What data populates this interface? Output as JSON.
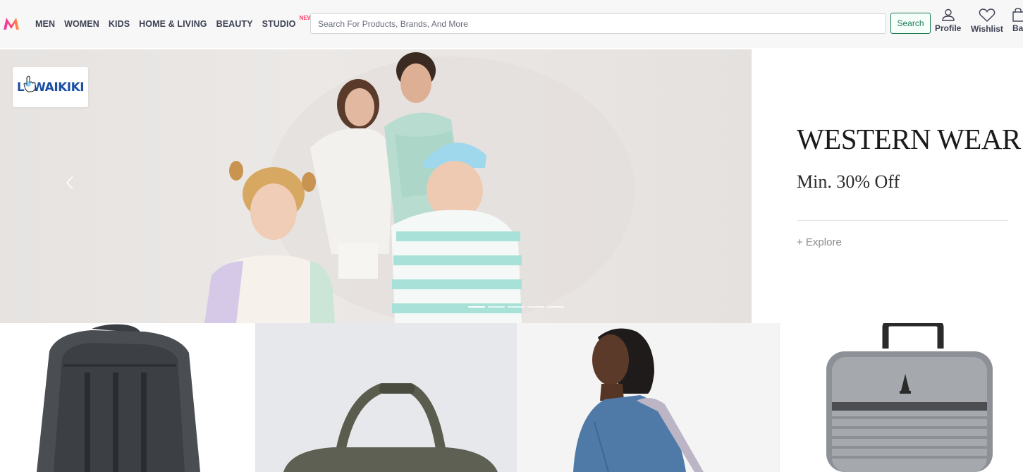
{
  "header": {
    "logo_icon": "myntra-logo-icon",
    "nav": [
      {
        "label": "MEN"
      },
      {
        "label": "WOMEN"
      },
      {
        "label": "KIDS"
      },
      {
        "label": "HOME & LIVING"
      },
      {
        "label": "BEAUTY"
      },
      {
        "label": "STUDIO",
        "badge": "NEW"
      }
    ],
    "search": {
      "placeholder": "Search For Products, Brands, And More",
      "button_label": "Search"
    },
    "actions": {
      "profile": {
        "label": "Profile",
        "icon": "user-icon"
      },
      "wishlist": {
        "label": "Wishlist",
        "icon": "heart-icon"
      },
      "bag": {
        "label": "Ba",
        "icon": "bag-icon"
      }
    }
  },
  "hero": {
    "brand": "LCWAIKIKI",
    "slide_count": 5,
    "active_slide": 1,
    "promo": {
      "title": "WESTERN WEAR",
      "subtitle": "Min. 30% Off",
      "cta": "+ Explore"
    }
  },
  "colors": {
    "brand_pink": "#ff3f6c",
    "search_green": "#1c7c54",
    "lcw_blue": "#1b4fa3"
  }
}
